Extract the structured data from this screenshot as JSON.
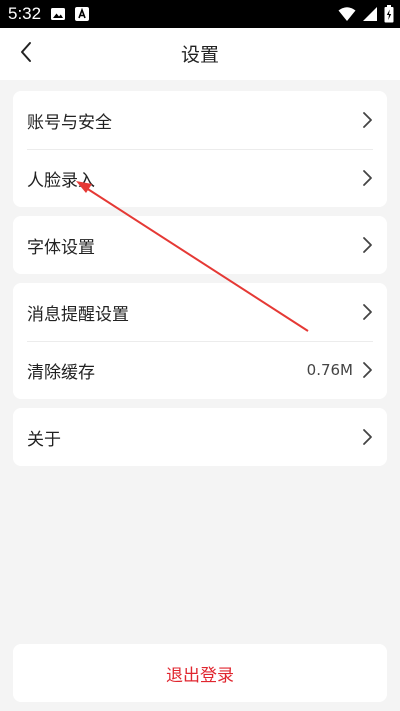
{
  "status_bar": {
    "time": "5:32",
    "left_icons": [
      "image-icon",
      "app-a-icon"
    ],
    "right_icons": [
      "wifi-icon",
      "signal-icon",
      "battery-charging-icon"
    ]
  },
  "nav": {
    "title": "设置",
    "back_icon": "chevron-left-icon"
  },
  "settings_groups": [
    {
      "items": [
        {
          "label": "账号与安全"
        },
        {
          "label": "人脸录入"
        }
      ]
    },
    {
      "items": [
        {
          "label": "字体设置"
        }
      ]
    },
    {
      "items": [
        {
          "label": "消息提醒设置"
        },
        {
          "label": "清除缓存",
          "value": "0.76M"
        }
      ]
    },
    {
      "items": [
        {
          "label": "关于"
        }
      ]
    }
  ],
  "logout": {
    "label": "退出登录"
  },
  "colors": {
    "background": "#f4f4f4",
    "card": "#ffffff",
    "logout_text": "#e0262f",
    "annotation_arrow": "#e53935"
  }
}
